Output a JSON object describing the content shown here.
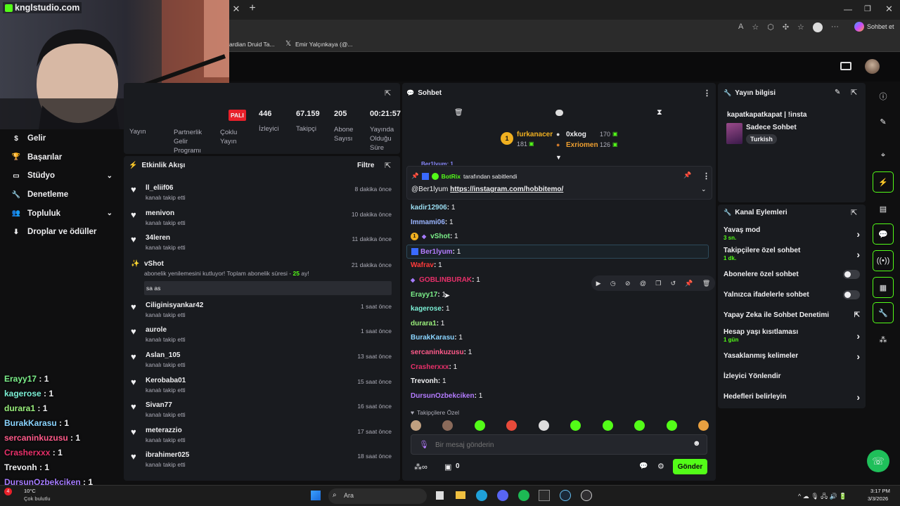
{
  "browser": {
    "tab_title": "knglstudio.com",
    "bookmarks": [
      "ardian Druid Ta...",
      "Emir Yalçınkaya (@..."
    ],
    "copilot_label": "Sohbet et"
  },
  "stats": {
    "badge": "PALI",
    "items": [
      {
        "label": "Partnerlik Gelir Programı",
        "value": ""
      },
      {
        "label": "Çoklu Yayın",
        "value": ""
      },
      {
        "label": "İzleyici",
        "value": "446"
      },
      {
        "label": "Takipçi",
        "value": "67.159"
      },
      {
        "label": "Abone Sayısı",
        "value": "205"
      },
      {
        "label": "Yayında Olduğu Süre",
        "value": "00:21:57"
      }
    ],
    "first_label": "Yayın"
  },
  "nav": {
    "items": [
      {
        "label": "Gelir",
        "icon": "dollar-icon"
      },
      {
        "label": "Başarılar",
        "icon": "trophy-icon"
      },
      {
        "label": "Stüdyo",
        "icon": "studio-icon",
        "chevron": true
      },
      {
        "label": "Denetleme",
        "icon": "wrench-icon"
      },
      {
        "label": "Topluluk",
        "icon": "users-icon",
        "chevron": true
      },
      {
        "label": "Droplar ve ödüller",
        "icon": "drops-icon"
      }
    ]
  },
  "overlay_chat": [
    {
      "user": "Erayy17",
      "value": "1",
      "color": "#7cf08a"
    },
    {
      "user": "kagerose",
      "value": "1",
      "color": "#7cf0d6"
    },
    {
      "user": "durara1",
      "value": "1",
      "color": "#9af07c"
    },
    {
      "user": "BurakKarasu",
      "value": "1",
      "color": "#8ad4ff"
    },
    {
      "user": "sercaninkuzusu",
      "value": "1",
      "color": "#ff5a8a"
    },
    {
      "user": "Crasherxxx",
      "value": "1",
      "color": "#e8306a"
    },
    {
      "user": "Trevonh",
      "value": "1",
      "color": "#efeff1"
    },
    {
      "user": "DursunOzbekciken",
      "value": "1",
      "color": "#a67cff"
    }
  ],
  "activity": {
    "title": "Etkinlik Akışı",
    "filter": "Filtre",
    "items": [
      {
        "name": "ll_eliif06",
        "sub": "kanalı takip etti",
        "time": "8 dakika önce"
      },
      {
        "name": "menivon",
        "sub": "kanalı takip etti",
        "time": "10 dakika önce"
      },
      {
        "name": "34leren",
        "sub": "kanalı takip etti",
        "time": "11 dakika önce"
      },
      {
        "name": "Ciliginisyankar42",
        "sub": "kanalı takip etti",
        "time": "1 saat önce"
      },
      {
        "name": "aurole",
        "sub": "kanalı takip etti",
        "time": "1 saat önce"
      },
      {
        "name": "Aslan_105",
        "sub": "kanalı takip etti",
        "time": "13 saat önce"
      },
      {
        "name": "Keroba​ba01",
        "sub": "kanalı takip etti",
        "time": "15 saat önce"
      },
      {
        "name": "Sivan77",
        "sub": "kanalı takip etti",
        "time": "16 saat önce"
      },
      {
        "name": "meterazzio",
        "sub": "kanalı takip etti",
        "time": "17 saat önce"
      },
      {
        "name": "ibrahimer025",
        "sub": "kanalı takip etti",
        "time": "18 saat önce"
      }
    ],
    "resub": {
      "name": "vShot",
      "time": "21 dakika önce",
      "text_a": "abonelik yenilemesini kutluyor! Toplam abonelik süresi - ",
      "months": "25",
      "text_b": " ay!",
      "message": "sa as"
    }
  },
  "chat": {
    "title": "Sohbet",
    "top_gifters": [
      {
        "rank": "1",
        "name": "furkanacer",
        "count": "181"
      },
      {
        "name": "0xkog",
        "count": "170"
      },
      {
        "name": "Exriomen",
        "count": "126"
      }
    ],
    "pinned": {
      "partial_top": "Ber1lyum: 1",
      "by_user": "BotRix",
      "by_text": "tarafından sabitlendi",
      "mention": "@Ber1lyum",
      "link": "https://instagram.com/hobbitemo/"
    },
    "messages": [
      {
        "user": "kadir12906",
        "text": "1",
        "color": "#9adcf0"
      },
      {
        "user": "Immami06",
        "text": "1",
        "color": "#9ab4ff"
      },
      {
        "user": "vShot",
        "text": "1",
        "color": "#7cf08a"
      },
      {
        "user": "Ber1lyum",
        "text": "1",
        "color": "#b47cff"
      },
      {
        "user": "Wafrav",
        "text": "1",
        "color": "#ff3a3a"
      },
      {
        "user": "GOBLINBURAK",
        "text": "1",
        "color": "#e8306a"
      },
      {
        "user": "Erayy17",
        "text": "1",
        "color": "#7cf08a"
      },
      {
        "user": "kagerose",
        "text": "1",
        "color": "#7cf0d6"
      },
      {
        "user": "durara1",
        "text": "1",
        "color": "#9af07c"
      },
      {
        "user": "BurakKarasu",
        "text": "1",
        "color": "#8ad4ff"
      },
      {
        "user": "sercaninkuzusu",
        "text": "1",
        "color": "#ff5a8a"
      },
      {
        "user": "Crasherxxx",
        "text": "1",
        "color": "#e8306a"
      },
      {
        "user": "Trevonh",
        "text": "1",
        "color": "#efeff1"
      },
      {
        "user": "DursunOzbekciken",
        "text": "1",
        "color": "#b47cff"
      }
    ],
    "followers_only": "Takipçilere Özel",
    "input_placeholder": "Bir mesaj gönderin",
    "points": "0",
    "send_label": "Gönder"
  },
  "stream_info": {
    "title": "Yayın bilgisi",
    "stream_title": "kapatkapatkapat | !insta",
    "category": "Sadece Sohbet",
    "tag": "Turkish"
  },
  "channel_actions": {
    "title": "Kanal Eylemleri",
    "rows": [
      {
        "label": "Yavaş mod",
        "sub": "3 sn.",
        "kind": "chevron"
      },
      {
        "label": "Takipçilere özel sohbet",
        "sub": "1 dk.",
        "kind": "chevron"
      },
      {
        "label": "Abonelere özel sohbet",
        "sub": "",
        "kind": "toggle"
      },
      {
        "label": "Yalnızca ifadelerle sohbet",
        "sub": "",
        "kind": "toggle"
      },
      {
        "label": "Yapay Zeka ile Sohbet Denetimi",
        "sub": "",
        "kind": "external"
      },
      {
        "label": "Hesap yaşı kısıtlaması",
        "sub": "1 gün",
        "kind": "chevron"
      },
      {
        "label": "Yasaklanmış kelimeler",
        "sub": "",
        "kind": "chevron"
      },
      {
        "label": "İzleyici Yönlendir",
        "sub": "",
        "kind": "none"
      },
      {
        "label": "Hedefleri belirleyin",
        "sub": "",
        "kind": "chevron"
      }
    ]
  },
  "taskbar": {
    "weather_temp": "10°C",
    "weather_desc": "Çok bulutlu",
    "search_label": "Ara",
    "time": "3:17 PM",
    "date": "3/3/2026"
  },
  "colors": {
    "accent": "#53fc18",
    "panel": "#191b1f",
    "bg": "#0f0f10"
  }
}
